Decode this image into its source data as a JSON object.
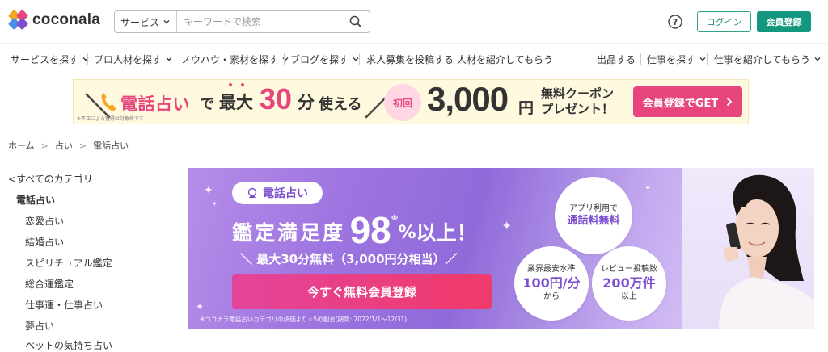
{
  "brand": {
    "name": "coconala"
  },
  "search": {
    "category": "サービス",
    "placeholder": "キーワードで検索"
  },
  "header": {
    "login": "ログイン",
    "register": "会員登録"
  },
  "nav": {
    "left": [
      "サービスを探す",
      "プロ人材を探す",
      "ノウハウ・素材を探す",
      "ブログを探す",
      "求人募集を投稿する",
      "人材を紹介してもらう"
    ],
    "right": [
      "出品する",
      "仕事を探す",
      "仕事を紹介してもらう"
    ]
  },
  "promo": {
    "phone_fortune": "電話占い",
    "de": "で",
    "saidai": "最大",
    "thirty": "30",
    "minutes": "分",
    "usable": "使える",
    "note": "※不正による獲得は対象外です",
    "first_time": "初回",
    "amount": "3,000",
    "yen": "円",
    "coupon_line1": "無料クーポン",
    "coupon_line2": "プレゼント！",
    "cta": "会員登録でGET"
  },
  "breadcrumb": [
    "ホーム",
    "占い",
    "電話占い"
  ],
  "sidebar": {
    "all_categories": "すべてのカテゴリ",
    "current": "電話占い",
    "items": [
      "恋愛占い",
      "結婚占い",
      "スピリチュアル鑑定",
      "総合運鑑定",
      "仕事運・仕事占い",
      "夢占い",
      "ペットの気持ち占い"
    ]
  },
  "hero": {
    "badge": "電話占い",
    "satisfaction_label": "鑑定満足度",
    "satisfaction_value": "98",
    "percent": "%",
    "above": "以上！",
    "asterisk": "※",
    "sub": "＼ 最大30分無料（3,000円分相当）／",
    "cta": "今すぐ無料会員登録",
    "footnote": "※ココナラ電話占いカテゴリの評価より☆5の割合(期間: 2022/1/1〜12/31)",
    "circle1": {
      "line1": "アプリ利用で",
      "line2": "通話料無料"
    },
    "circle2": {
      "line1": "業界最安水準",
      "line2": "100円/分",
      "line3": "から"
    },
    "circle3": {
      "line1": "レビュー投稿数",
      "line2": "200万件",
      "line3": "以上"
    }
  },
  "colors": {
    "accent_green": "#14977f",
    "pink": "#e8457f",
    "purple": "#7d4fd0"
  }
}
